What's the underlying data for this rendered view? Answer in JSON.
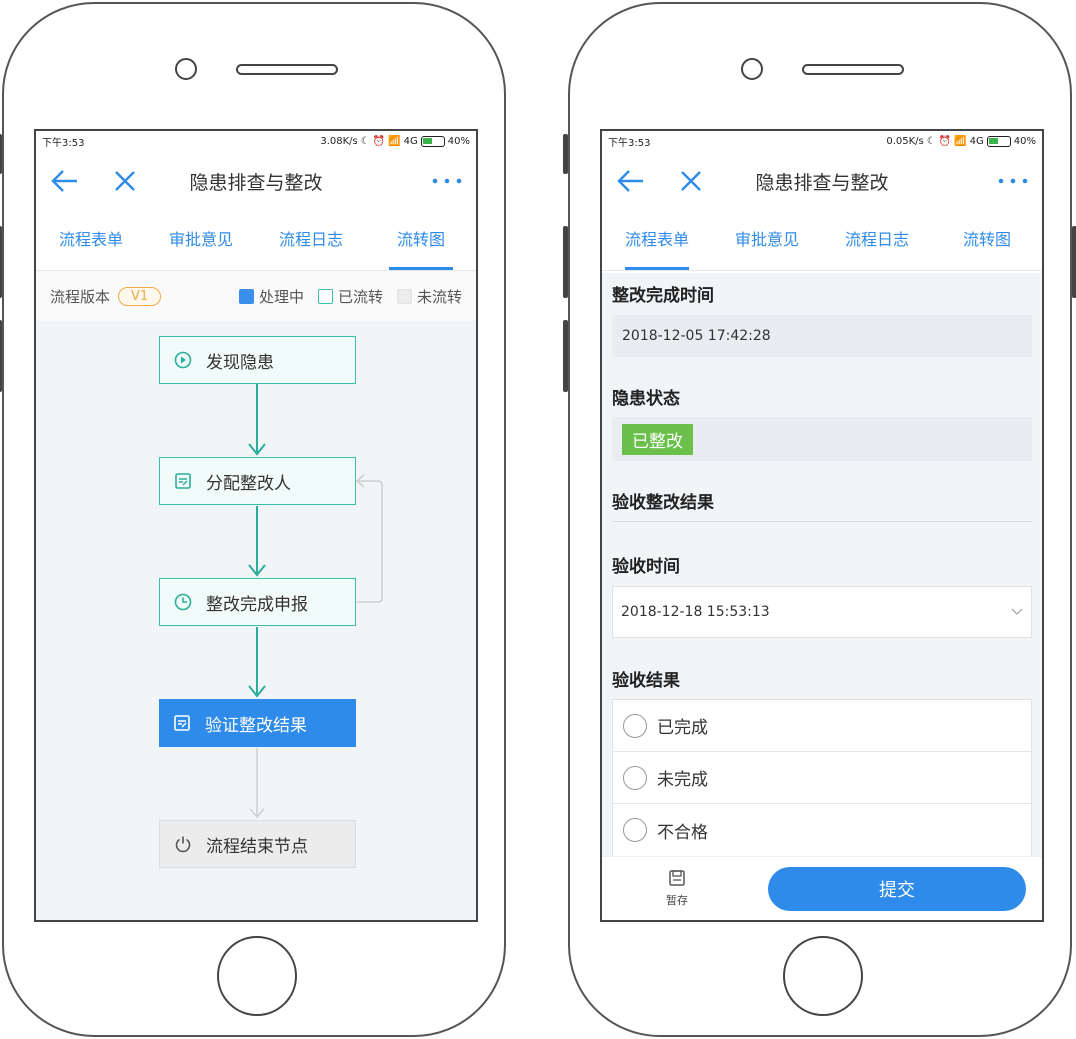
{
  "left_phone": {
    "status": {
      "time": "下午3:53",
      "speed": "3.08K/s",
      "network": "4G",
      "battery": "40%"
    },
    "nav": {
      "title": "隐患排查与整改"
    },
    "tabs": [
      "流程表单",
      "审批意见",
      "流程日志",
      "流转图"
    ],
    "active_tab": "流转图",
    "legend": {
      "version_label": "流程版本",
      "version": "V1",
      "processing": "处理中",
      "done": "已流转",
      "pending": "未流转"
    },
    "flow": {
      "nodes": [
        {
          "label": "发现隐患",
          "state": "done",
          "icon": "play-circle-icon"
        },
        {
          "label": "分配整改人",
          "state": "done",
          "icon": "form-edit-icon"
        },
        {
          "label": "整改完成申报",
          "state": "done",
          "icon": "clock-icon"
        },
        {
          "label": "验证整改结果",
          "state": "processing",
          "icon": "form-edit-icon"
        },
        {
          "label": "流程结束节点",
          "state": "pending",
          "icon": "power-icon"
        }
      ]
    }
  },
  "right_phone": {
    "status": {
      "time": "下午3:53",
      "speed": "0.05K/s",
      "network": "4G",
      "battery": "40%"
    },
    "nav": {
      "title": "隐患排查与整改"
    },
    "tabs": [
      "流程表单",
      "审批意见",
      "流程日志",
      "流转图"
    ],
    "active_tab": "流程表单",
    "form": {
      "completion_time_label": "整改完成时间",
      "completion_time": "2018-12-05  17:42:28",
      "status_label": "隐患状态",
      "status_value": "已整改",
      "section_title": "验收整改结果",
      "accept_time_label": "验收时间",
      "accept_time": "2018-12-18  15:53:13",
      "result_label": "验收结果",
      "result_options": [
        "已完成",
        "未完成",
        "不合格"
      ]
    },
    "bottom": {
      "save_label": "暂存",
      "submit_label": "提交"
    }
  },
  "colors": {
    "primary": "#2f8bea",
    "teal": "#3bbfa8",
    "green_tag": "#6bc04b",
    "orange": "#f0a848"
  }
}
